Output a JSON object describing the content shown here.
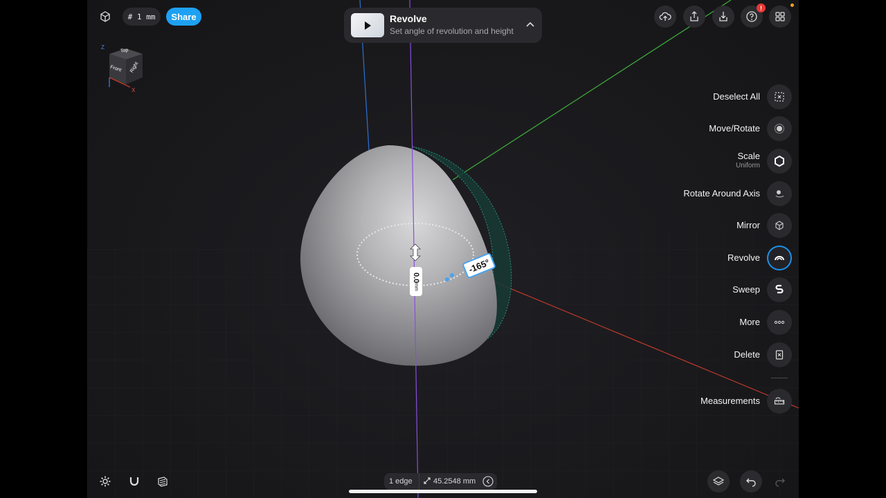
{
  "topbar": {
    "units_label": "# 1 mm",
    "share_label": "Share",
    "notification_badge": "!"
  },
  "hint": {
    "title": "Revolve",
    "subtitle": "Set angle of revolution and height"
  },
  "viewcube": {
    "top": "Top",
    "front": "Front",
    "right": "Right",
    "axis_z": "Z",
    "axis_x": "X"
  },
  "tools": [
    {
      "label": "Deselect All",
      "sub": "",
      "icon": "deselect-icon"
    },
    {
      "label": "Move/Rotate",
      "sub": "",
      "icon": "move-rotate-icon"
    },
    {
      "label": "Scale",
      "sub": "Uniform",
      "icon": "scale-icon"
    },
    {
      "label": "Rotate Around Axis",
      "sub": "",
      "icon": "rotate-axis-icon"
    },
    {
      "label": "Mirror",
      "sub": "",
      "icon": "mirror-icon"
    },
    {
      "label": "Revolve",
      "sub": "",
      "icon": "revolve-icon",
      "active": true
    },
    {
      "label": "Sweep",
      "sub": "",
      "icon": "sweep-icon"
    },
    {
      "label": "More",
      "sub": "",
      "icon": "more-icon"
    },
    {
      "label": "Delete",
      "sub": "",
      "icon": "delete-icon"
    },
    {
      "label": "Measurements",
      "sub": "",
      "icon": "ruler-icon"
    }
  ],
  "viewport": {
    "angle_label": "-165°",
    "height_label": "0.0",
    "height_unit": "mm"
  },
  "statusbar": {
    "selection": "1 edge",
    "length": "45.2548 mm"
  },
  "colors": {
    "accent": "#1ea1f2",
    "active_ring": "#1e90e6",
    "axis_green": "#3fae3a",
    "axis_red": "#c0392b",
    "axis_blue": "#2f6fd6",
    "revolve_axis": "#8a4ee0",
    "sweep_teal": "#2fa58c",
    "badge_red": "#e53935"
  }
}
